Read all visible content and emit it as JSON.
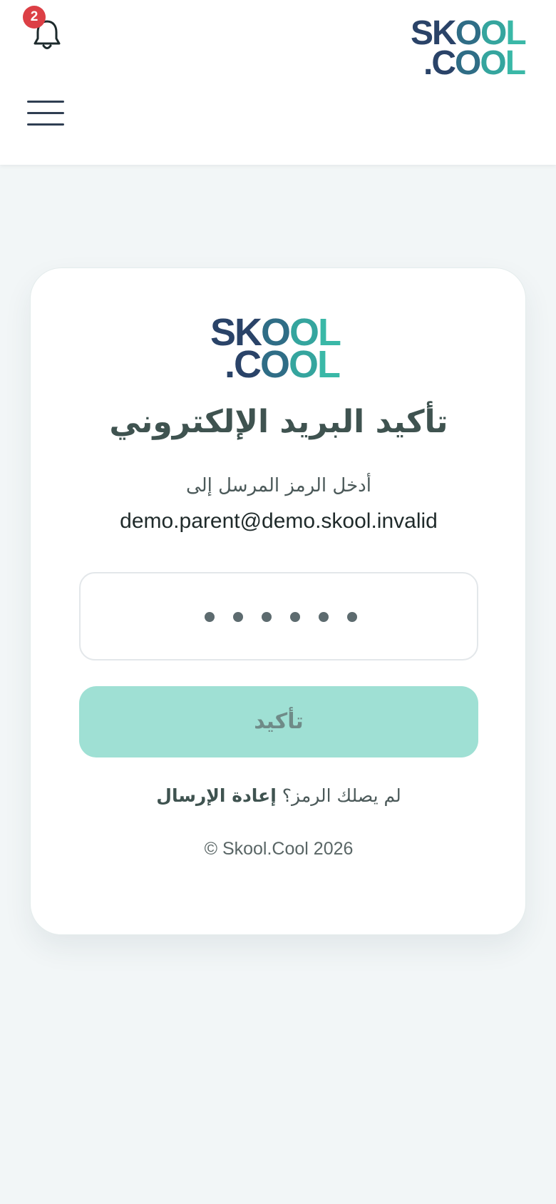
{
  "header": {
    "notification_count": "2",
    "logo": {
      "line1_a": "SK",
      "line1_b": "O",
      "line1_c": "O",
      "line1_d": "L",
      "line2_a": ".C",
      "line2_b": "O",
      "line2_c": "O",
      "line2_d": "L"
    }
  },
  "card": {
    "logo": {
      "line1_a": "SK",
      "line1_b": "O",
      "line1_c": "O",
      "line1_d": "L",
      "line2_a": ".C",
      "line2_b": "O",
      "line2_c": "O",
      "line2_d": "L"
    },
    "title": "تأكيد البريد الإلكتروني",
    "subtitle": "أدخل الرمز المرسل إلى",
    "email": "demo.parent@demo.skool.invalid",
    "code_length": 6,
    "confirm_label": "تأكيد",
    "resend_prompt": "لم يصلك الرمز؟",
    "resend_link": "إعادة الإرسال",
    "copyright": "© Skool.Cool 2026"
  },
  "colors": {
    "page_bg": "#f2f6f7",
    "navy": "#2a4368",
    "teal": "#3ab8a7",
    "button_disabled": "#9fe0d4",
    "badge": "#dc3f45"
  },
  "icons": {
    "notifications": "bell-icon",
    "menu": "hamburger-icon"
  }
}
